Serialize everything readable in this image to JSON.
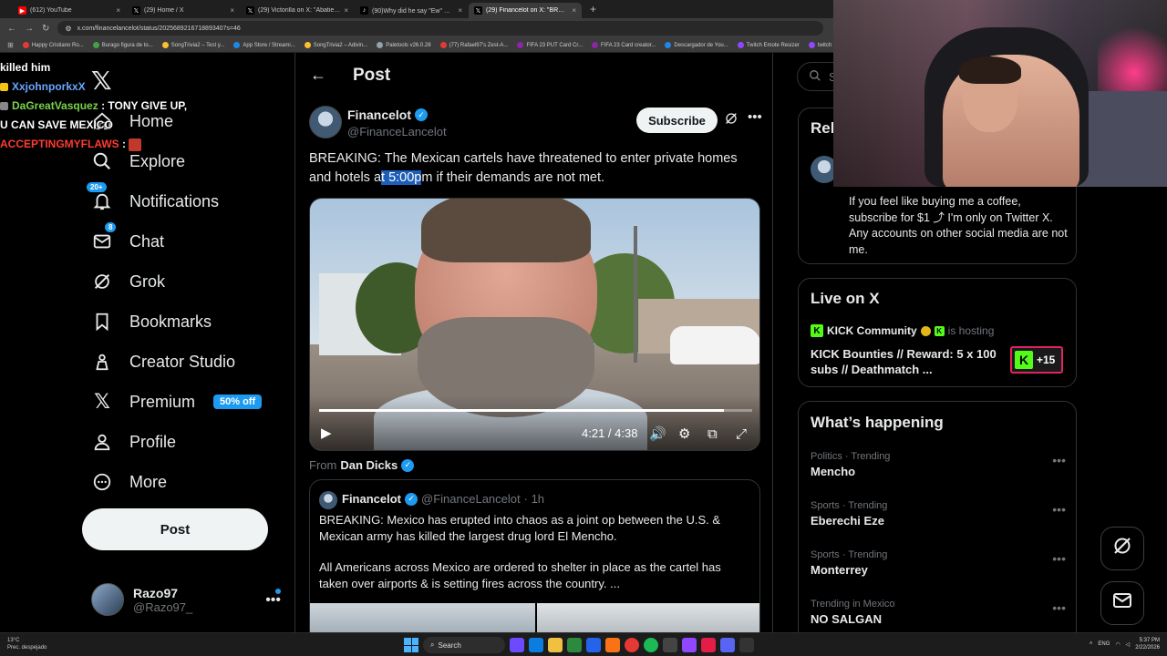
{
  "browser": {
    "tabs": [
      {
        "label": "(612) YouTube",
        "color": "#ff0000",
        "active": false
      },
      {
        "label": "(29) Home / X",
        "color": "#000000",
        "active": false
      },
      {
        "label": "(29) Victorilla on X: \"Abatiero...",
        "color": "#000000",
        "active": false
      },
      {
        "label": "(90)Why did he say \"Ew\" 😭 #...",
        "color": "#000000",
        "active": false
      },
      {
        "label": "(29) Financelot on X: \"BREAKIN...",
        "color": "#000000",
        "active": true
      }
    ],
    "url": "x.com/financelancelot/status/2025689216718893407s=46",
    "bookmarks": [
      "Happy Cristiano Ro...",
      "Burago figura de to...",
      "SongTrivia2 – Test y...",
      "App Store / Streami...",
      "SongTrivia2 – Adivin...",
      "Paletools v26.0.28",
      "(77) Rafael97's Zest-A...",
      "FIFA 23 PUT Card Cr...",
      "FIFA 23 Card creator...",
      "Descargador de You...",
      "Twitch Emote Resizer",
      "twitch emote re..."
    ]
  },
  "chat": [
    {
      "user": "",
      "message": "killed him",
      "color": "#ffffff"
    },
    {
      "user": "XxjohnporkxX",
      "message": "",
      "color": "#6aa6ff"
    },
    {
      "user": "DaGreatVasquez",
      "message": ": TONY GIVE UP,",
      "color": "#7bd24a"
    },
    {
      "user": "",
      "message": "U CAN SAVE MEXICO",
      "color": "#ffffff"
    },
    {
      "user": "ACCEPTINGMYFLAWS",
      "message": ":",
      "color": "#ff3b30"
    }
  ],
  "sidebar": {
    "items": [
      {
        "label": "Home",
        "icon": "home-icon",
        "badge": ""
      },
      {
        "label": "Explore",
        "icon": "search-icon",
        "badge": ""
      },
      {
        "label": "Notifications",
        "icon": "bell-icon",
        "badge": "20+"
      },
      {
        "label": "Chat",
        "icon": "mail-icon",
        "badge": "8"
      },
      {
        "label": "Grok",
        "icon": "grok-icon",
        "badge": ""
      },
      {
        "label": "Bookmarks",
        "icon": "bookmark-icon",
        "badge": ""
      },
      {
        "label": "Creator Studio",
        "icon": "creator-studio-icon",
        "badge": ""
      },
      {
        "label": "Premium",
        "icon": "x-logo-icon",
        "badge": "50% off"
      },
      {
        "label": "Profile",
        "icon": "profile-icon",
        "badge": ""
      },
      {
        "label": "More",
        "icon": "more-circle-icon",
        "badge": ""
      }
    ],
    "post_label": "Post",
    "account": {
      "name": "Razo97",
      "handle": "@Razo97_"
    }
  },
  "main": {
    "header_title": "Post",
    "tweet": {
      "author": "Financelot",
      "handle": "@FinanceLancelot",
      "subscribe_label": "Subscribe",
      "text_before": "BREAKING: The Mexican cartels have threatened to enter private homes and hotels a",
      "text_highlight": "t 5:00p",
      "text_after": "m if their demands are not met.",
      "video": {
        "current_time": "4:21",
        "duration": "4:38",
        "progress": 0.935
      },
      "from_label": "From",
      "from_name": "Dan Dicks"
    },
    "quote": {
      "author": "Financelot",
      "handle": "@FinanceLancelot",
      "time": "· 1h",
      "text1": "BREAKING: Mexico has erupted into chaos as a joint op between the U.S. & Mexican army has killed the largest drug lord El Mencho.",
      "text2": "All Americans across Mexico are ordered to shelter in place as the cartel has taken over airports & is setting fires across the country.  ..."
    }
  },
  "right": {
    "search_placeholder": "Se",
    "relevant_title": "Rel",
    "relevant_bio": "If you feel like buying me a coffee, subscribe for $1 ⤴ I'm only on Twitter X. Any accounts on other social media are not me.",
    "live_title": "Live on X",
    "live_host": "KICK Community",
    "live_hosting": "is hosting",
    "live_stream_title": "KICK Bounties // Reward: 5 x 100 subs // Deathmatch ...",
    "live_count": "+15",
    "happening_title": "What’s happening",
    "trends": [
      {
        "meta": "Politics · Trending",
        "name": "Mencho"
      },
      {
        "meta": "Sports · Trending",
        "name": "Eberechi Eze"
      },
      {
        "meta": "Sports · Trending",
        "name": "Monterrey"
      },
      {
        "meta": "Trending in Mexico",
        "name": "NO SALGAN"
      }
    ]
  },
  "taskbar": {
    "weather_temp": "13°C",
    "weather_desc": "Prec. despejado",
    "search_label": "Search",
    "lang": "ENG",
    "time": "5:37 PM",
    "date": "2/22/2026"
  },
  "colors": {
    "accent": "#1d9bf0",
    "background": "#000000",
    "text": "#e7e9ea",
    "muted": "#71767b",
    "border": "#2f3336"
  }
}
